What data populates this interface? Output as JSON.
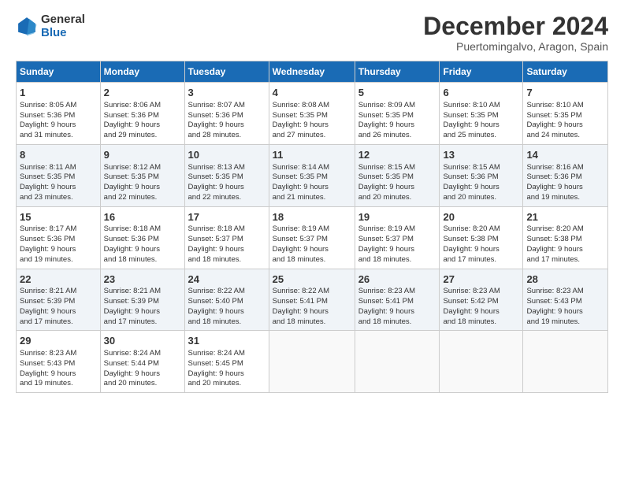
{
  "header": {
    "logo_line1": "General",
    "logo_line2": "Blue",
    "title": "December 2024",
    "subtitle": "Puertomingalvo, Aragon, Spain"
  },
  "calendar": {
    "days_of_week": [
      "Sunday",
      "Monday",
      "Tuesday",
      "Wednesday",
      "Thursday",
      "Friday",
      "Saturday"
    ],
    "weeks": [
      [
        {
          "day": "1",
          "lines": [
            "Sunrise: 8:05 AM",
            "Sunset: 5:36 PM",
            "Daylight: 9 hours",
            "and 31 minutes."
          ]
        },
        {
          "day": "2",
          "lines": [
            "Sunrise: 8:06 AM",
            "Sunset: 5:36 PM",
            "Daylight: 9 hours",
            "and 29 minutes."
          ]
        },
        {
          "day": "3",
          "lines": [
            "Sunrise: 8:07 AM",
            "Sunset: 5:36 PM",
            "Daylight: 9 hours",
            "and 28 minutes."
          ]
        },
        {
          "day": "4",
          "lines": [
            "Sunrise: 8:08 AM",
            "Sunset: 5:35 PM",
            "Daylight: 9 hours",
            "and 27 minutes."
          ]
        },
        {
          "day": "5",
          "lines": [
            "Sunrise: 8:09 AM",
            "Sunset: 5:35 PM",
            "Daylight: 9 hours",
            "and 26 minutes."
          ]
        },
        {
          "day": "6",
          "lines": [
            "Sunrise: 8:10 AM",
            "Sunset: 5:35 PM",
            "Daylight: 9 hours",
            "and 25 minutes."
          ]
        },
        {
          "day": "7",
          "lines": [
            "Sunrise: 8:10 AM",
            "Sunset: 5:35 PM",
            "Daylight: 9 hours",
            "and 24 minutes."
          ]
        }
      ],
      [
        {
          "day": "8",
          "lines": [
            "Sunrise: 8:11 AM",
            "Sunset: 5:35 PM",
            "Daylight: 9 hours",
            "and 23 minutes."
          ]
        },
        {
          "day": "9",
          "lines": [
            "Sunrise: 8:12 AM",
            "Sunset: 5:35 PM",
            "Daylight: 9 hours",
            "and 22 minutes."
          ]
        },
        {
          "day": "10",
          "lines": [
            "Sunrise: 8:13 AM",
            "Sunset: 5:35 PM",
            "Daylight: 9 hours",
            "and 22 minutes."
          ]
        },
        {
          "day": "11",
          "lines": [
            "Sunrise: 8:14 AM",
            "Sunset: 5:35 PM",
            "Daylight: 9 hours",
            "and 21 minutes."
          ]
        },
        {
          "day": "12",
          "lines": [
            "Sunrise: 8:15 AM",
            "Sunset: 5:35 PM",
            "Daylight: 9 hours",
            "and 20 minutes."
          ]
        },
        {
          "day": "13",
          "lines": [
            "Sunrise: 8:15 AM",
            "Sunset: 5:36 PM",
            "Daylight: 9 hours",
            "and 20 minutes."
          ]
        },
        {
          "day": "14",
          "lines": [
            "Sunrise: 8:16 AM",
            "Sunset: 5:36 PM",
            "Daylight: 9 hours",
            "and 19 minutes."
          ]
        }
      ],
      [
        {
          "day": "15",
          "lines": [
            "Sunrise: 8:17 AM",
            "Sunset: 5:36 PM",
            "Daylight: 9 hours",
            "and 19 minutes."
          ]
        },
        {
          "day": "16",
          "lines": [
            "Sunrise: 8:18 AM",
            "Sunset: 5:36 PM",
            "Daylight: 9 hours",
            "and 18 minutes."
          ]
        },
        {
          "day": "17",
          "lines": [
            "Sunrise: 8:18 AM",
            "Sunset: 5:37 PM",
            "Daylight: 9 hours",
            "and 18 minutes."
          ]
        },
        {
          "day": "18",
          "lines": [
            "Sunrise: 8:19 AM",
            "Sunset: 5:37 PM",
            "Daylight: 9 hours",
            "and 18 minutes."
          ]
        },
        {
          "day": "19",
          "lines": [
            "Sunrise: 8:19 AM",
            "Sunset: 5:37 PM",
            "Daylight: 9 hours",
            "and 18 minutes."
          ]
        },
        {
          "day": "20",
          "lines": [
            "Sunrise: 8:20 AM",
            "Sunset: 5:38 PM",
            "Daylight: 9 hours",
            "and 17 minutes."
          ]
        },
        {
          "day": "21",
          "lines": [
            "Sunrise: 8:20 AM",
            "Sunset: 5:38 PM",
            "Daylight: 9 hours",
            "and 17 minutes."
          ]
        }
      ],
      [
        {
          "day": "22",
          "lines": [
            "Sunrise: 8:21 AM",
            "Sunset: 5:39 PM",
            "Daylight: 9 hours",
            "and 17 minutes."
          ]
        },
        {
          "day": "23",
          "lines": [
            "Sunrise: 8:21 AM",
            "Sunset: 5:39 PM",
            "Daylight: 9 hours",
            "and 17 minutes."
          ]
        },
        {
          "day": "24",
          "lines": [
            "Sunrise: 8:22 AM",
            "Sunset: 5:40 PM",
            "Daylight: 9 hours",
            "and 18 minutes."
          ]
        },
        {
          "day": "25",
          "lines": [
            "Sunrise: 8:22 AM",
            "Sunset: 5:41 PM",
            "Daylight: 9 hours",
            "and 18 minutes."
          ]
        },
        {
          "day": "26",
          "lines": [
            "Sunrise: 8:23 AM",
            "Sunset: 5:41 PM",
            "Daylight: 9 hours",
            "and 18 minutes."
          ]
        },
        {
          "day": "27",
          "lines": [
            "Sunrise: 8:23 AM",
            "Sunset: 5:42 PM",
            "Daylight: 9 hours",
            "and 18 minutes."
          ]
        },
        {
          "day": "28",
          "lines": [
            "Sunrise: 8:23 AM",
            "Sunset: 5:43 PM",
            "Daylight: 9 hours",
            "and 19 minutes."
          ]
        }
      ],
      [
        {
          "day": "29",
          "lines": [
            "Sunrise: 8:23 AM",
            "Sunset: 5:43 PM",
            "Daylight: 9 hours",
            "and 19 minutes."
          ]
        },
        {
          "day": "30",
          "lines": [
            "Sunrise: 8:24 AM",
            "Sunset: 5:44 PM",
            "Daylight: 9 hours",
            "and 20 minutes."
          ]
        },
        {
          "day": "31",
          "lines": [
            "Sunrise: 8:24 AM",
            "Sunset: 5:45 PM",
            "Daylight: 9 hours",
            "and 20 minutes."
          ]
        },
        null,
        null,
        null,
        null
      ]
    ]
  }
}
